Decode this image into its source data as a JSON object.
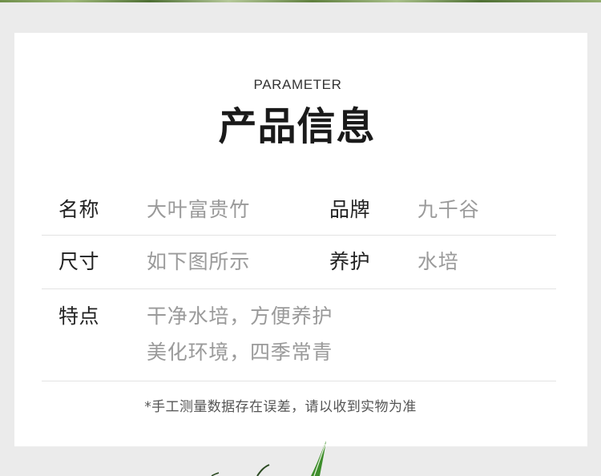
{
  "header": {
    "eyebrow": "PARAMETER",
    "title": "产品信息"
  },
  "specs": {
    "rows": [
      {
        "left": {
          "label": "名称",
          "value": "大叶富贵竹"
        },
        "right": {
          "label": "品牌",
          "value": "九千谷"
        }
      },
      {
        "left": {
          "label": "尺寸",
          "value": "如下图所示"
        },
        "right": {
          "label": "养护",
          "value": "水培"
        }
      }
    ],
    "features": {
      "label": "特点",
      "lines": [
        "干净水培，方便养护",
        "美化环境，四季常青"
      ]
    }
  },
  "footnote": "*手工测量数据存在误差，请以收到实物为准",
  "colors": {
    "background": "#ebebeb",
    "card": "#ffffff",
    "label": "#222222",
    "value": "#9a9a9a",
    "divider": "#e3e3e3",
    "leaf": "#3e8e2c"
  }
}
